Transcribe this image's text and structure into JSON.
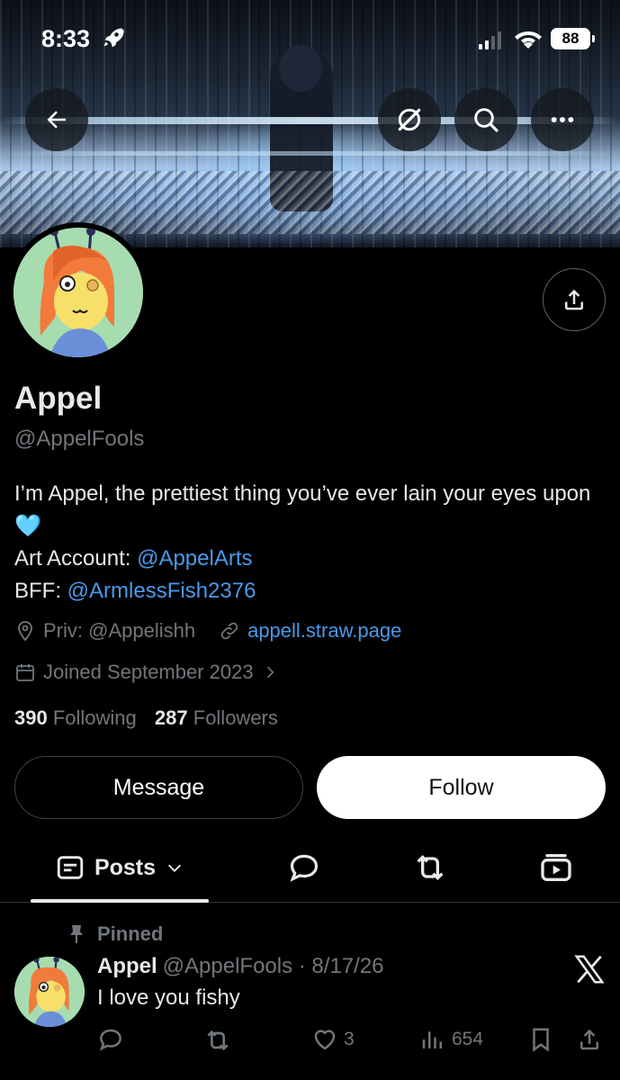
{
  "status_bar": {
    "time": "8:33",
    "battery": "88"
  },
  "profile": {
    "name": "Appel",
    "handle": "@AppelFools",
    "bio_line1": "I’m Appel, the prettiest thing you’ve ever lain your eyes upon",
    "bio_emoji": "🩵",
    "art_label": "Art Account: ",
    "art_mention": "@AppelArts",
    "bff_label": "BFF: ",
    "bff_mention": "@ArmlessFish2376",
    "location": "Priv: @Appelishh",
    "website": "appell.straw.page",
    "joined": "Joined September 2023",
    "following_count": "390",
    "following_label": "Following",
    "followers_count": "287",
    "followers_label": "Followers"
  },
  "buttons": {
    "message": "Message",
    "follow": "Follow"
  },
  "tabs": {
    "posts": "Posts"
  },
  "post": {
    "pinned_label": "Pinned",
    "name": "Appel",
    "handle_date": "@AppelFools · 8/17/26",
    "text": "I love you fishy",
    "likes": "3",
    "views": "654"
  },
  "colors": {
    "accent": "#4a99e9",
    "muted": "#71767b",
    "text": "#e7e9ea",
    "background": "#000000"
  },
  "icons": [
    "rocket-icon",
    "signal-icon",
    "wifi-icon",
    "back-arrow-icon",
    "grok-icon",
    "search-icon",
    "more-icon",
    "share-icon",
    "location-icon",
    "link-icon",
    "calendar-icon",
    "chevron-right-icon",
    "posts-icon",
    "chevron-down-icon",
    "replies-icon",
    "reposts-icon",
    "media-icon",
    "pin-icon",
    "x-logo-icon",
    "reply-icon",
    "retweet-icon",
    "like-icon",
    "views-icon",
    "bookmark-icon"
  ]
}
